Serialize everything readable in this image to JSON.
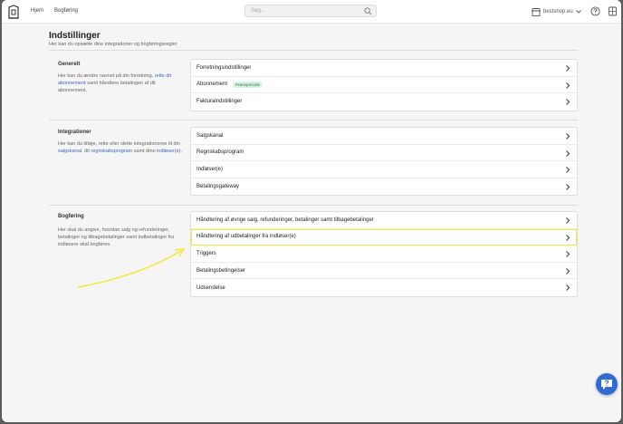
{
  "nav": {
    "home": "Hjem",
    "bookkeeping": "Bogføring"
  },
  "search": {
    "placeholder": "Søg..."
  },
  "shop": {
    "name": "bestshop.eu"
  },
  "page": {
    "title": "Indstillinger",
    "subtitle": "Her kan du opsætte dine integrationer og bogføringsregler"
  },
  "sections": {
    "general": {
      "title": "Generelt",
      "desc_1": "Her kan du ændre navnet på din forretning, ",
      "link_1": "rette dit abonnement",
      "desc_2": " samt håndtere betalingen af dit abonnement.",
      "rows": [
        "Forretningsindstillinger",
        "Abonnement",
        "Fakturaindstillinger"
      ],
      "badge": "Prøveperiode"
    },
    "integrations": {
      "title": "Integrationer",
      "desc_1": "Her kan du tilføje, rette eller slette integrationerne til din ",
      "link_1": "salgskanal",
      "desc_2": ", dit ",
      "link_2": "regnskabsprogram",
      "desc_3": " samt dine ",
      "link_3": "indløser(e)",
      "desc_4": ".",
      "rows": [
        "Salgskanal",
        "Regnskabsprogram",
        "Indløser(e)",
        "Betalingsgateway"
      ]
    },
    "bookkeeping": {
      "title": "Bogføring",
      "desc": "Her skal du angive, hvordan salg og refunderinger, betalinger og tilbagebetalinger samt indbetalinger fra indløsere skal bogføres.",
      "rows": [
        "Håndtering af øvrige salg, refunderinger, betalinger samt tilbagebetalinger",
        "Håndtering af udbetalinger fra indløser(e)",
        "Triggers",
        "Betalingsbetingelser",
        "Udsendelse"
      ]
    }
  },
  "colors": {
    "link": "#3a66c9",
    "highlight": "#f2ea2a",
    "badge_bg": "#d9f3e3",
    "help_button": "#2f6bd6"
  }
}
